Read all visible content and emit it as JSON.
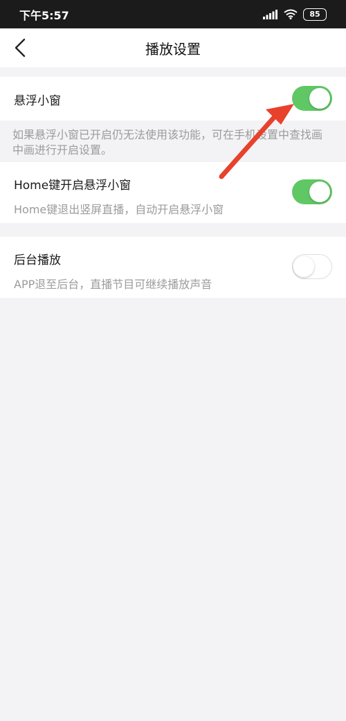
{
  "status_bar": {
    "time": "下午5:57",
    "battery": "85"
  },
  "header": {
    "title": "播放设置"
  },
  "settings": {
    "floating_window": {
      "title": "悬浮小窗",
      "enabled": true
    },
    "floating_note": "如果悬浮小窗已开启仍无法使用该功能，可在手机设置中查找画中画进行开启设置。",
    "home_floating": {
      "title": "Home键开启悬浮小窗",
      "description": "Home键退出竖屏直播，自动开启悬浮小窗",
      "enabled": true
    },
    "background_play": {
      "title": "后台播放",
      "description": "APP退至后台，直播节目可继续播放声音",
      "enabled": false
    }
  },
  "colors": {
    "toggle_on": "#5fc865",
    "annotation_arrow": "#e8412c"
  }
}
